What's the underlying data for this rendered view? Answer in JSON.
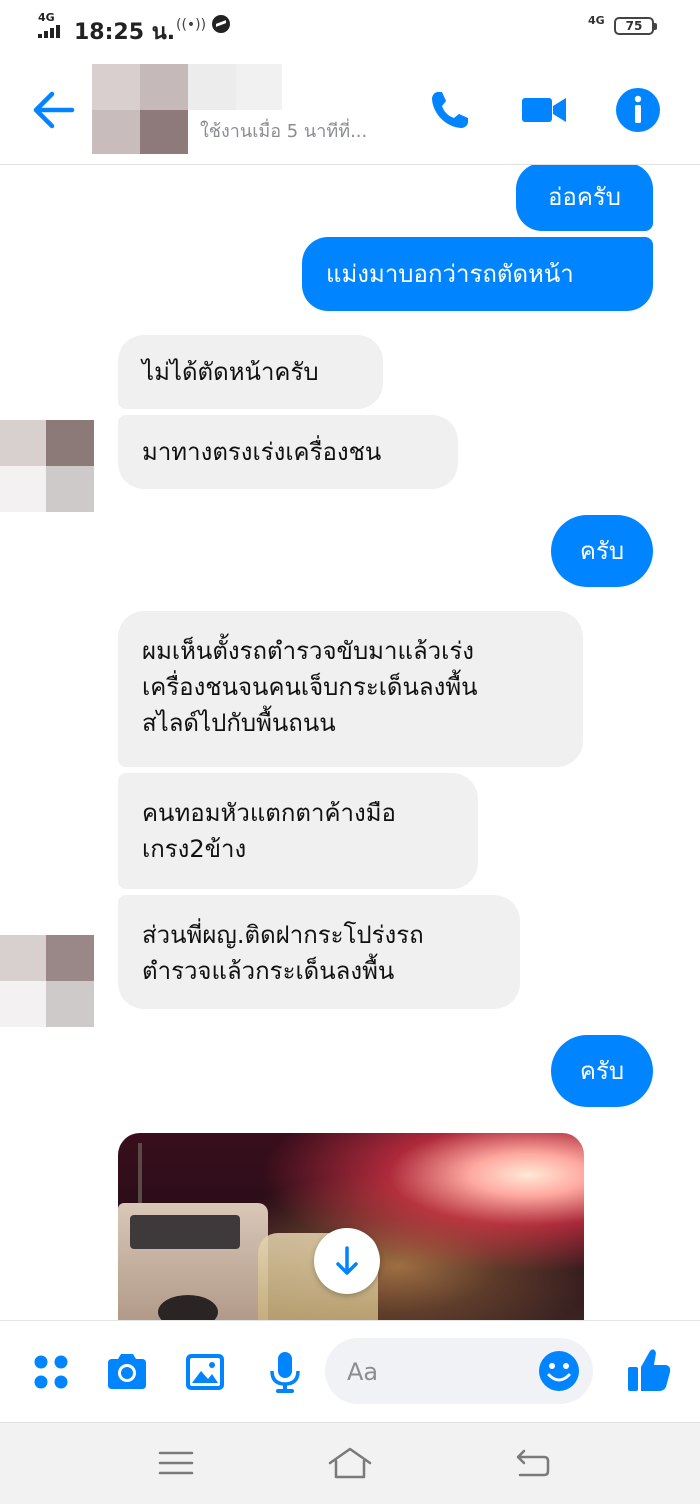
{
  "status_bar": {
    "network_left": "4G",
    "time": "18:25 น.",
    "network_right": "4G",
    "battery": "75",
    "wifi_icon": "hotspot-icon",
    "messenger_icon": "messenger-icon"
  },
  "header": {
    "contact_status": "ใช้งานเมื่อ 5 นาทีที่...",
    "back_icon": "arrow-left-icon",
    "call_icon": "phone-icon",
    "video_icon": "video-camera-icon",
    "info_icon": "info-icon"
  },
  "messages": [
    {
      "dir": "out",
      "lines": [
        "อ่อครับ"
      ]
    },
    {
      "dir": "out",
      "lines": [
        "แม่งมาบอกว่ารถตัดหน้า"
      ]
    },
    {
      "dir": "in",
      "lines": [
        "ไม่ได้ตัดหน้าครับ"
      ]
    },
    {
      "dir": "in",
      "lines": [
        "มาทางตรงเร่งเครื่องชน"
      ]
    },
    {
      "dir": "out",
      "lines": [
        "ครับ"
      ]
    },
    {
      "dir": "in",
      "lines": [
        "ผมเห็นตั้งรถตำรวจขับมาแล้วเร่ง",
        "เครื่องชนจนคนเจ็บกระเด็นลงพื้น",
        "สไลด์ไปกับพื้นถนน"
      ]
    },
    {
      "dir": "in",
      "lines": [
        "คนทอมหัวแตกตาค้างมือ",
        "เกรง2ข้าง"
      ]
    },
    {
      "dir": "in",
      "lines": [
        "ส่วนพี่ผญ.ติดฝากระโปร่งรถ",
        "ตำรวจแล้วกระเด็นลงพื้น"
      ]
    },
    {
      "dir": "out",
      "lines": [
        "ครับ"
      ]
    }
  ],
  "composer": {
    "placeholder": "Aa",
    "icons": [
      "apps-icon",
      "camera-icon",
      "image-icon",
      "microphone-icon",
      "emoji-icon",
      "thumbs-up-icon"
    ]
  },
  "navbar": {
    "icons": [
      "menu-icon",
      "home-icon",
      "back-icon"
    ]
  },
  "colors": {
    "accent": "#0084ff",
    "incoming_bubble": "#f1f0f0"
  }
}
